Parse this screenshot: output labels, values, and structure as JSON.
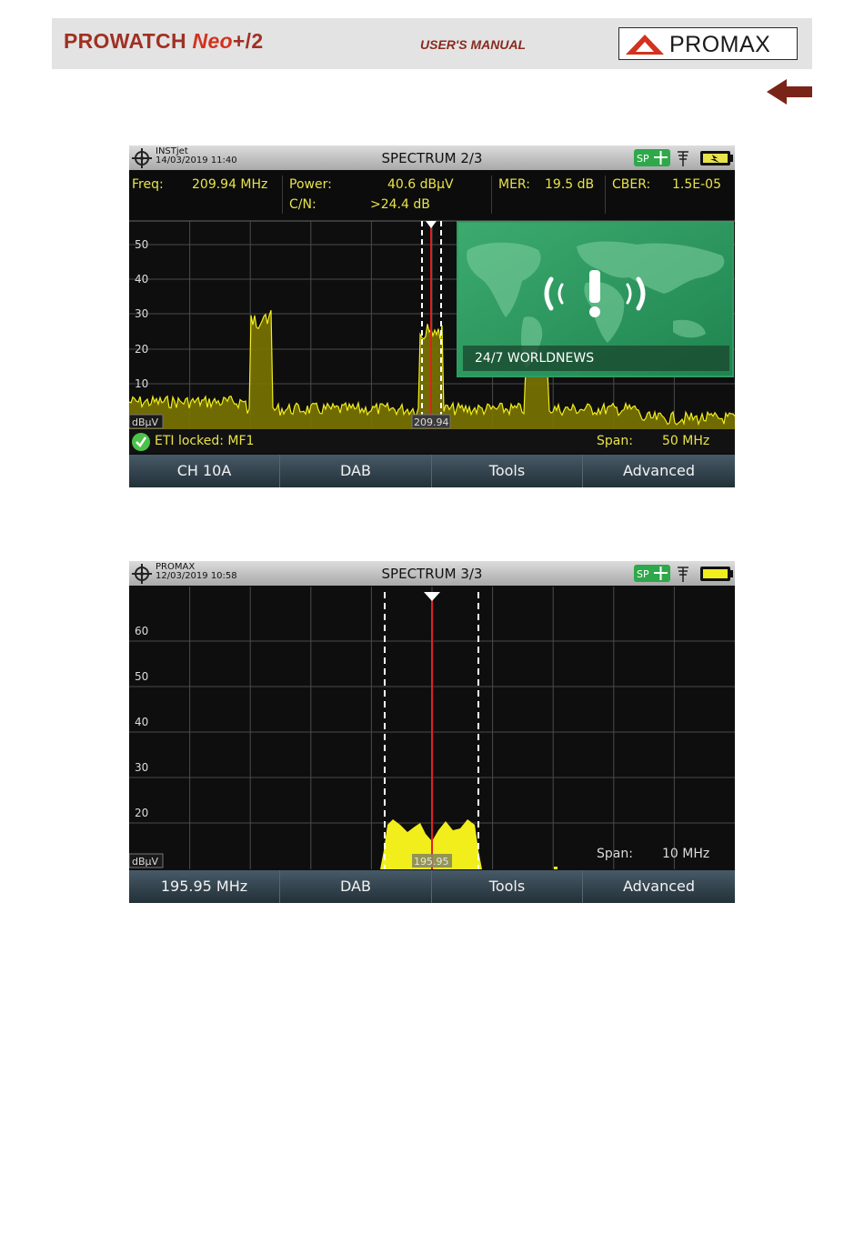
{
  "header": {
    "product_main": "PROWATCH ",
    "product_neo": "Neo",
    "product_suffix": "+/2",
    "manual": "USER'S MANUAL",
    "logo": "PROMAX"
  },
  "colors": {
    "trace": "#f2ee1c",
    "marker": "#e02020",
    "meas_text": "#e8e34a",
    "header_red": "#a03023"
  },
  "screen1": {
    "device": "INSTjet",
    "datetime": "14/03/2019 11:40",
    "title": "SPECTRUM 2/3",
    "icons": [
      "sp-badge",
      "move-icon",
      "antenna-icon",
      "battery-charging-icon"
    ],
    "measurements": {
      "freq_label": "Freq:",
      "freq_value": "209.94 MHz",
      "power_label": "Power:",
      "power_value": "40.6 dBµV",
      "cn_label": "C/N:",
      "cn_value": ">24.4 dB",
      "mer_label": "MER:",
      "mer_value": "19.5 dB",
      "cber_label": "CBER:",
      "cber_value": "1.5E-05"
    },
    "y_ticks": [
      "50",
      "40",
      "30",
      "20",
      "10"
    ],
    "unit": "dBµV",
    "marker_label": "209.94",
    "service_name": "24/7 WORLDNEWS",
    "status_text": "ETI locked: MF1",
    "span_label": "Span:",
    "span_value": "50 MHz",
    "softkeys": [
      "CH 10A",
      "DAB",
      "Tools",
      "Advanced"
    ]
  },
  "screen2": {
    "device": "PROMAX",
    "datetime": "12/03/2019 10:58",
    "title": "SPECTRUM 3/3",
    "icons": [
      "sp-badge",
      "move-icon",
      "antenna-icon",
      "battery-icon"
    ],
    "y_ticks": [
      "60",
      "50",
      "40",
      "30",
      "20"
    ],
    "unit": "dBµV",
    "marker_label": "195.95",
    "span_label": "Span:",
    "span_value": "10 MHz",
    "softkeys": [
      "195.95 MHz",
      "DAB",
      "Tools",
      "Advanced"
    ]
  }
}
